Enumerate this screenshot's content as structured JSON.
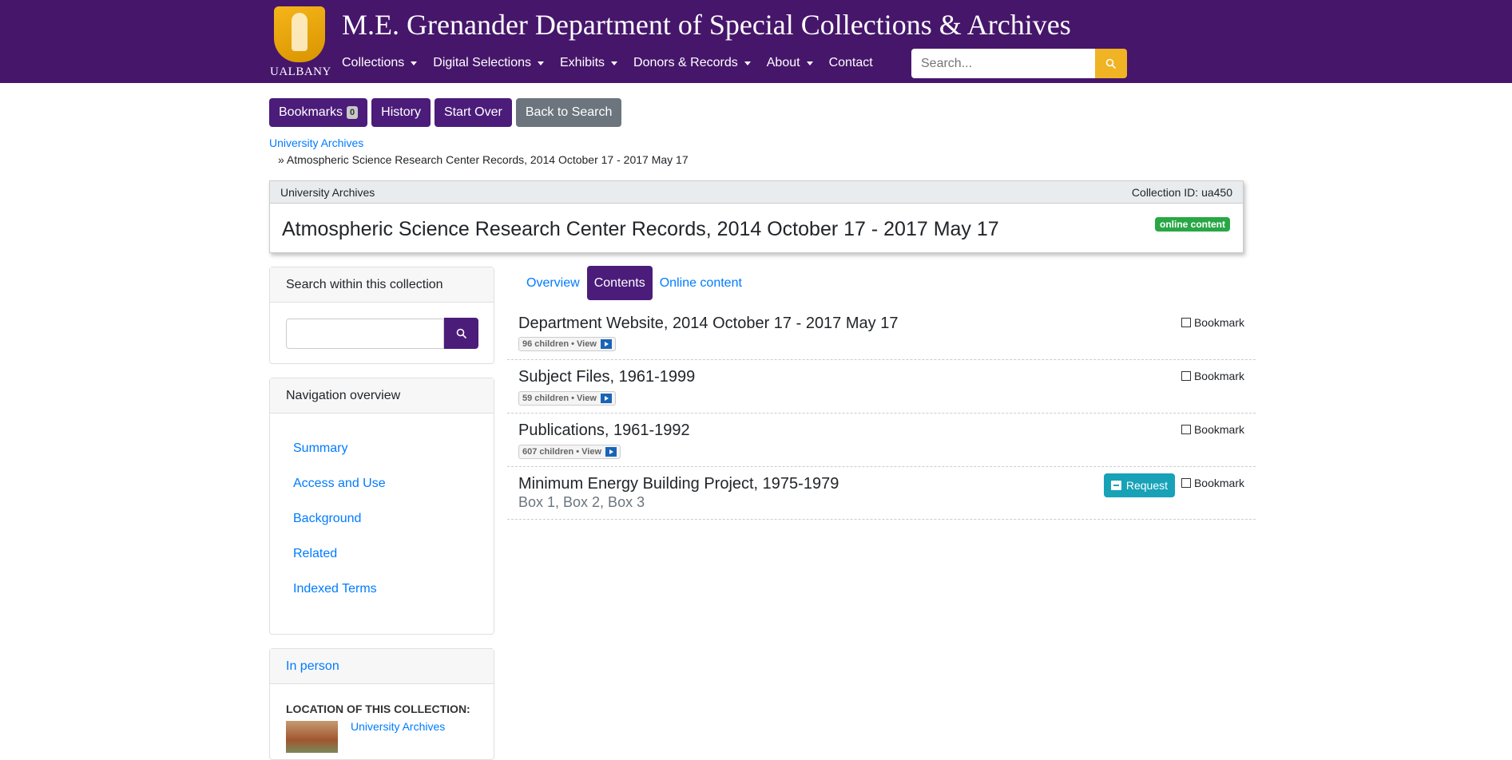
{
  "header": {
    "logo_text": "UALBANY",
    "site_title": "M.E. Grenander Department of Special Collections & Archives",
    "nav": [
      {
        "label": "Collections",
        "dropdown": true
      },
      {
        "label": "Digital Selections",
        "dropdown": true
      },
      {
        "label": "Exhibits",
        "dropdown": true
      },
      {
        "label": "Donors & Records",
        "dropdown": true
      },
      {
        "label": "About",
        "dropdown": true
      },
      {
        "label": "Contact",
        "dropdown": false
      }
    ],
    "search_placeholder": "Search..."
  },
  "actions": {
    "bookmarks_label": "Bookmarks",
    "bookmarks_count": "0",
    "history_label": "History",
    "start_over_label": "Start Over",
    "back_label": "Back to Search"
  },
  "breadcrumb": {
    "parent": "University Archives",
    "current": "» Atmospheric Science Research Center Records, 2014 October 17 - 2017 May 17"
  },
  "collection": {
    "repository": "University Archives",
    "collection_id": "Collection ID: ua450",
    "title": "Atmospheric Science Research Center Records, 2014 October 17 - 2017 May 17",
    "badge": "online content"
  },
  "sidebar": {
    "search_heading": "Search within this collection",
    "nav_heading": "Navigation overview",
    "nav_links": [
      "Summary",
      "Access and Use",
      "Background",
      "Related",
      "Indexed Terms"
    ],
    "in_person_heading": "In person",
    "location_label": "LOCATION OF THIS COLLECTION:",
    "location_link": "University Archives"
  },
  "tabs": [
    {
      "label": "Overview",
      "active": false
    },
    {
      "label": "Contents",
      "active": true
    },
    {
      "label": "Online content",
      "active": false
    }
  ],
  "contents": [
    {
      "title": "Department Website, 2014 October 17 - 2017 May 17",
      "children": "96 children • View",
      "bookmark": "Bookmark"
    },
    {
      "title": "Subject Files, 1961-1999",
      "children": "59 children • View",
      "bookmark": "Bookmark"
    },
    {
      "title": "Publications, 1961-1992",
      "children": "607 children • View",
      "bookmark": "Bookmark"
    },
    {
      "title": "Minimum Energy Building Project, 1975-1979",
      "containers": "Box 1, Box 2, Box 3",
      "request": "Request",
      "bookmark": "Bookmark"
    }
  ],
  "colors": {
    "brand_purple": "#46166b",
    "accent_gold": "#f0b323",
    "link": "#007bff",
    "online_green": "#28a745",
    "request_teal": "#17a2b8"
  }
}
